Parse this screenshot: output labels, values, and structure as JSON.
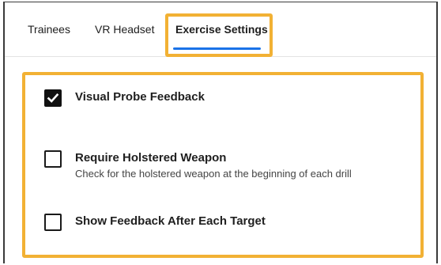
{
  "tabs": [
    {
      "label": "Trainees"
    },
    {
      "label": "VR Headset"
    },
    {
      "label": "Exercise Settings",
      "active": true
    }
  ],
  "settings": [
    {
      "label": "Visual Probe Feedback",
      "description": "",
      "checked": true
    },
    {
      "label": "Require Holstered Weapon",
      "description": "Check for the holstered weapon at the beginning of each drill",
      "checked": false
    },
    {
      "label": "Show Feedback After Each Target",
      "description": "",
      "checked": false
    }
  ],
  "colors": {
    "highlight": "#f2b134",
    "active_tab_indicator": "#1a73e8"
  },
  "icons": {
    "checkmark": "checkmark-icon"
  }
}
